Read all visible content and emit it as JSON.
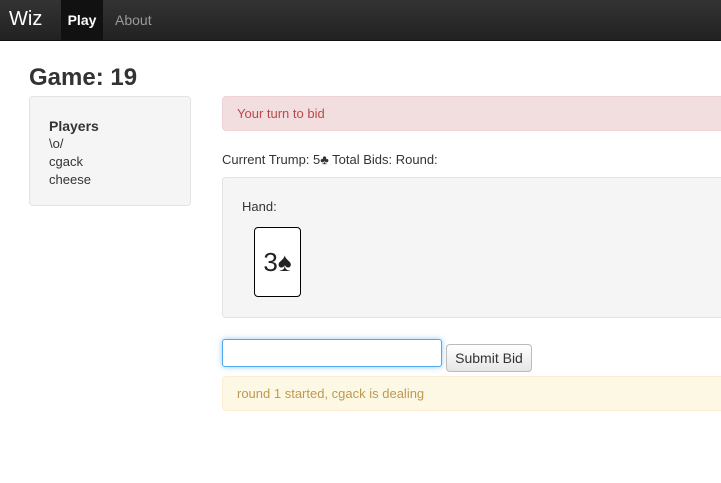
{
  "navbar": {
    "brand": "Wiz",
    "links": [
      {
        "label": "Play",
        "active": true
      },
      {
        "label": "About",
        "active": false
      }
    ]
  },
  "page": {
    "title": "Game: 19"
  },
  "sidebar": {
    "heading": "Players",
    "players": [
      "\\o/",
      "cgack",
      "cheese"
    ]
  },
  "turn_alert": {
    "text": "Your turn to bid"
  },
  "status": {
    "text": "Current Trump: 5♣ Total Bids: Round:"
  },
  "hand": {
    "label": "Hand:",
    "cards": [
      {
        "rank": "3",
        "suit": "♠"
      }
    ]
  },
  "bid_form": {
    "input_value": "",
    "submit_label": "Submit Bid"
  },
  "log_alert": {
    "text": "round 1 started, cgack is dealing"
  },
  "colors": {
    "navbar": "#222222",
    "error_bg": "#f2dede",
    "error_text": "#b94a48",
    "info_bg": "#fcf8e3",
    "info_text": "#c09853",
    "input_focus": "#52a8ec"
  }
}
